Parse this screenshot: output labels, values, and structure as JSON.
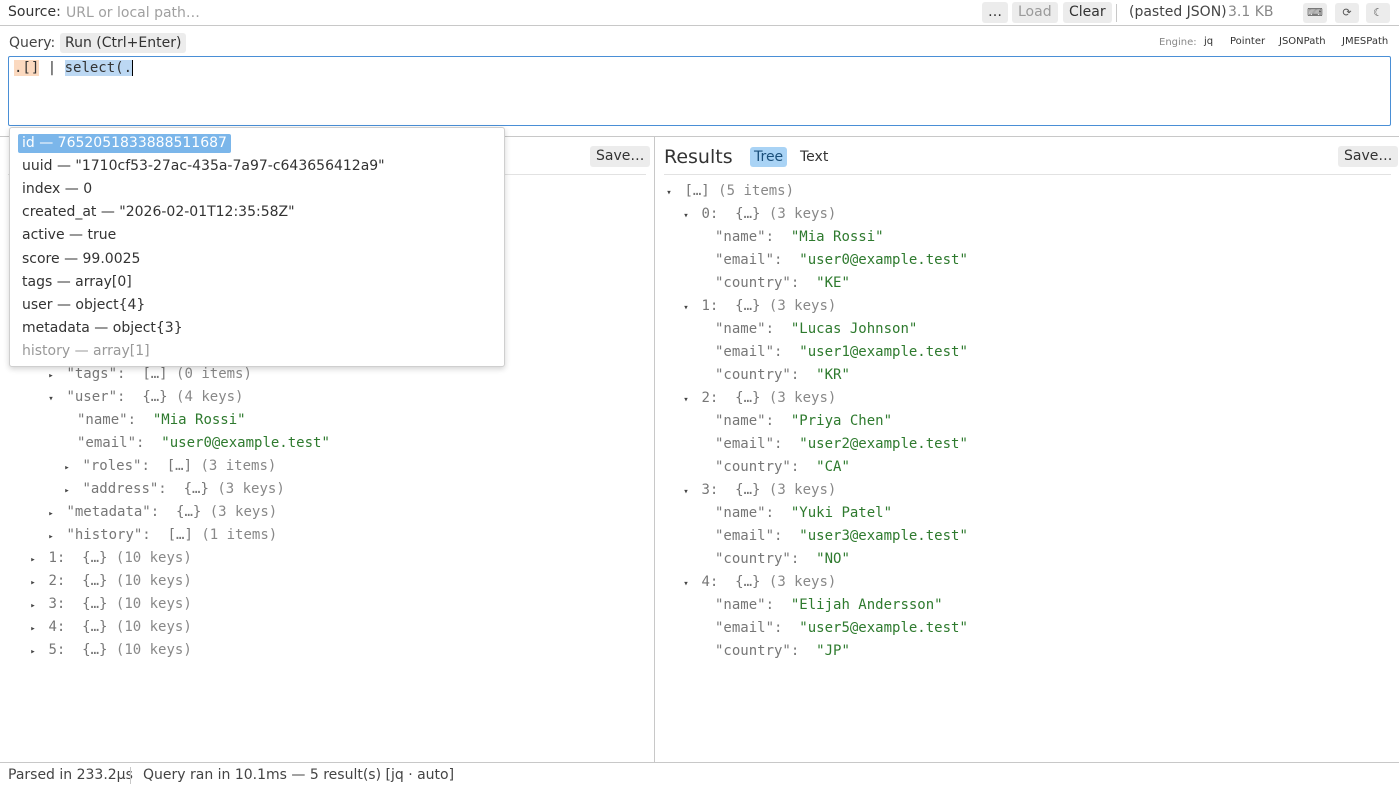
{
  "source": {
    "label": "Source:",
    "placeholder": "URL or local path…",
    "browse_label": "…",
    "load_label": "Load",
    "clear_label": "Clear",
    "info": "(pasted JSON)",
    "size": "3.1 KB"
  },
  "toolbar_icons": [
    "keyboard-icon",
    "refresh-icon",
    "moon-icon"
  ],
  "query": {
    "label": "Query:",
    "run_label": "Run  (Ctrl+Enter)",
    "engine_label": "Engine:",
    "engines": [
      "jq",
      "Pointer",
      "JSONPath",
      "JMESPath"
    ],
    "text_part1": ".[]",
    "text_part2": " | ",
    "text_part3": "select(."
  },
  "autocomplete": [
    {
      "text": "id — 7652051833888511687",
      "selected": true
    },
    {
      "text": "uuid — \"1710cf53-27ac-435a-7a97-c643656412a9\""
    },
    {
      "text": "index — 0"
    },
    {
      "text": "created_at — \"2026-02-01T12:35:58Z\""
    },
    {
      "text": "active — true"
    },
    {
      "text": "score — 99.0025"
    },
    {
      "text": "tags — array[0]"
    },
    {
      "text": "user — object{4}"
    },
    {
      "text": "metadata — object{3}"
    },
    {
      "text": "history — array[1]"
    }
  ],
  "input_pane": {
    "save_label": "Save…",
    "rows": [
      {
        "a": "▸",
        "k": "\"tags\":",
        "v": "[…]",
        "m": "(0 items)"
      },
      {
        "a": "▾",
        "k": "\"user\":",
        "v": "{…}",
        "m": "(4 keys)"
      },
      {
        "k": "\"name\":",
        "s": "\"Mia Rossi\""
      },
      {
        "k": "\"email\":",
        "s": "\"user0@example.test\""
      },
      {
        "a": "▸",
        "k": "\"roles\":",
        "v": "[…]",
        "m": "(3 items)"
      },
      {
        "a": "▸",
        "k": "\"address\":",
        "v": "{…}",
        "m": "(3 keys)"
      },
      {
        "a": "▸",
        "k": "\"metadata\":",
        "v": "{…}",
        "m": "(3 keys)"
      },
      {
        "a": "▸",
        "k": "\"history\":",
        "v": "[…]",
        "m": "(1 items)"
      },
      {
        "a": "▸",
        "k": "1:",
        "v": "{…}",
        "m": "(10 keys)"
      },
      {
        "a": "▸",
        "k": "2:",
        "v": "{…}",
        "m": "(10 keys)"
      },
      {
        "a": "▸",
        "k": "3:",
        "v": "{…}",
        "m": "(10 keys)"
      },
      {
        "a": "▸",
        "k": "4:",
        "v": "{…}",
        "m": "(10 keys)"
      },
      {
        "a": "▸",
        "k": "5:",
        "v": "{…}",
        "m": "(10 keys)"
      }
    ]
  },
  "results": {
    "title": "Results",
    "tab_tree": "Tree",
    "tab_text": "Text",
    "save_label": "Save…",
    "root": {
      "v": "[…]",
      "m": "(5 items)"
    },
    "items": [
      {
        "idx": "0:",
        "v": "{…}",
        "m": "(3 keys)",
        "name": "\"Mia Rossi\"",
        "email": "\"user0@example.test\"",
        "country": "\"KE\""
      },
      {
        "idx": "1:",
        "v": "{…}",
        "m": "(3 keys)",
        "name": "\"Lucas Johnson\"",
        "email": "\"user1@example.test\"",
        "country": "\"KR\""
      },
      {
        "idx": "2:",
        "v": "{…}",
        "m": "(3 keys)",
        "name": "\"Priya Chen\"",
        "email": "\"user2@example.test\"",
        "country": "\"CA\""
      },
      {
        "idx": "3:",
        "v": "{…}",
        "m": "(3 keys)",
        "name": "\"Yuki Patel\"",
        "email": "\"user3@example.test\"",
        "country": "\"NO\""
      },
      {
        "idx": "4:",
        "v": "{…}",
        "m": "(3 keys)",
        "name": "\"Elijah Andersson\"",
        "email": "\"user5@example.test\"",
        "country": "\"JP\""
      }
    ],
    "key_name": "\"name\":",
    "key_email": "\"email\":",
    "key_country": "\"country\":"
  },
  "status": {
    "parsed": "Parsed in 233.2µs",
    "query": "Query ran in 10.1ms — 5 result(s) [jq · auto]"
  }
}
